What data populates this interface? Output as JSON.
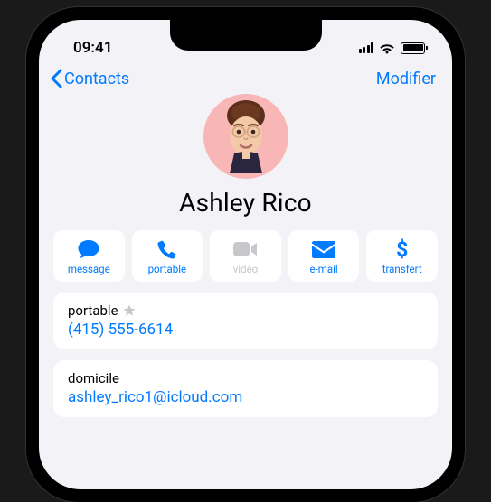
{
  "status": {
    "time": "09:41"
  },
  "nav": {
    "back_label": "Contacts",
    "edit_label": "Modifier"
  },
  "contact": {
    "name": "Ashley Rico"
  },
  "actions": {
    "message": "message",
    "call": "portable",
    "video": "vidéo",
    "email": "e-mail",
    "pay": "transfert"
  },
  "phone_card": {
    "label": "portable",
    "value": "(415) 555-6614"
  },
  "email_card": {
    "label": "domicile",
    "value": "ashley_rico1@icloud.com"
  },
  "colors": {
    "accent": "#007aff",
    "background": "#f2f2f7",
    "avatar_bg": "#f9b6b6"
  }
}
